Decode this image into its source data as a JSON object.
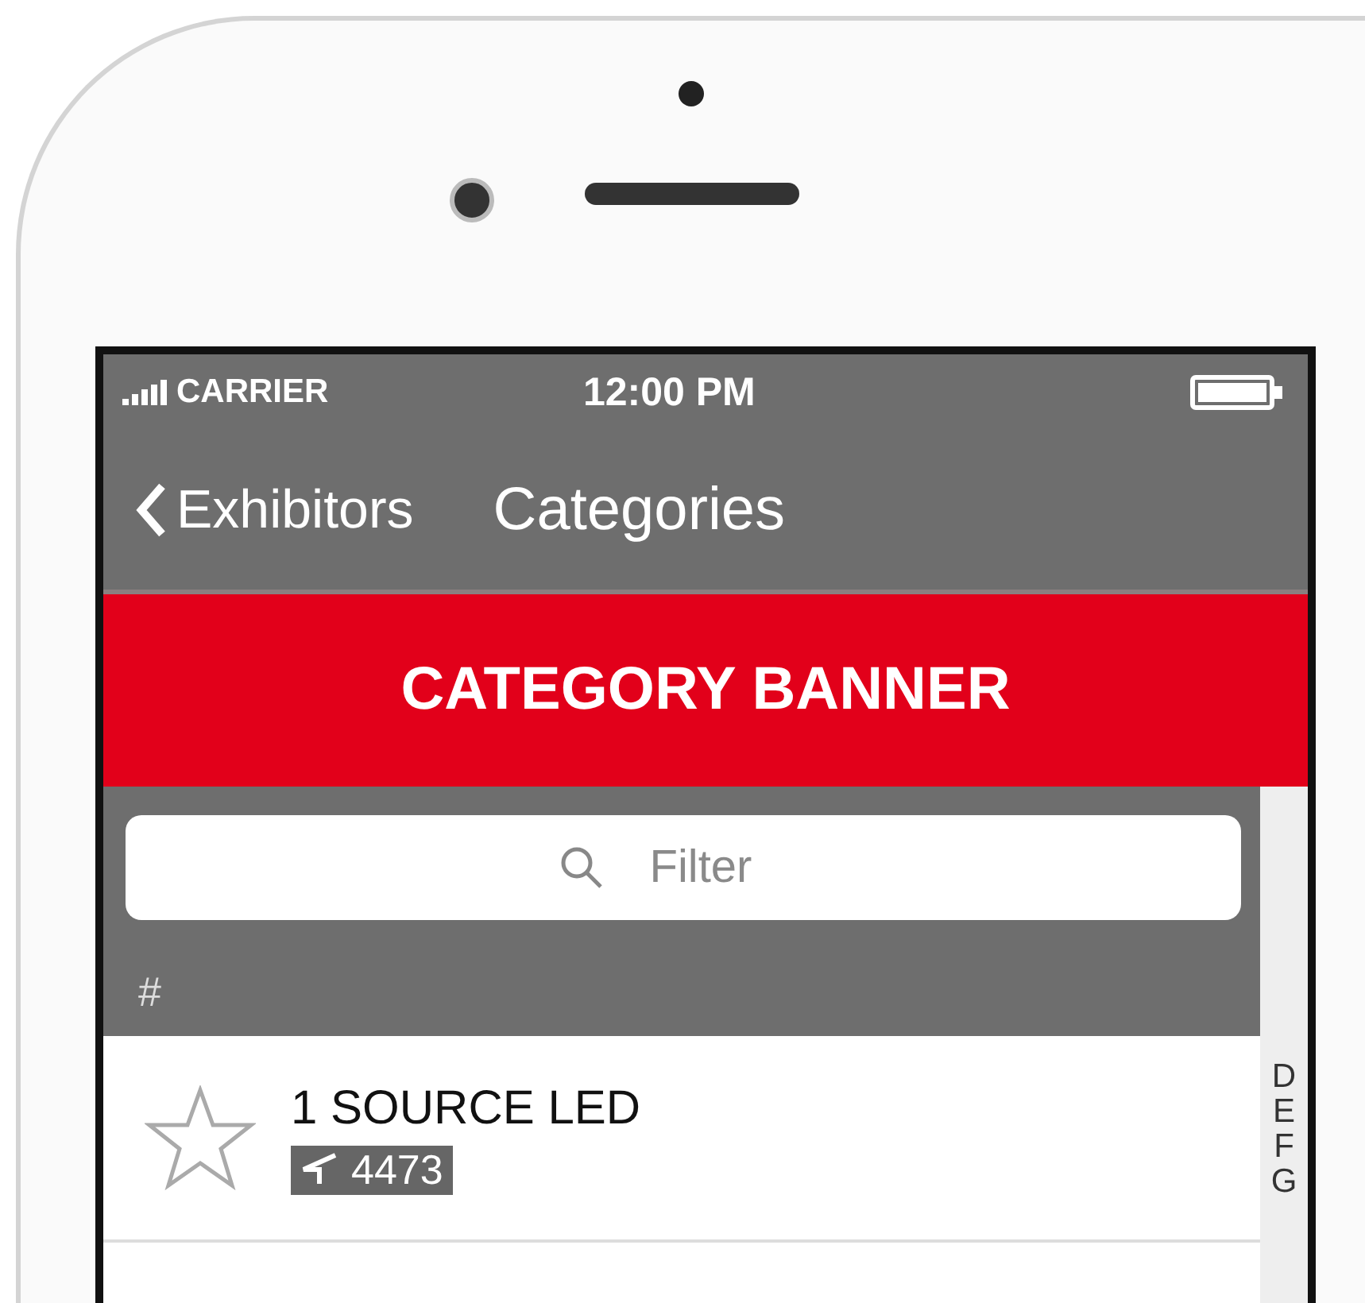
{
  "status_bar": {
    "carrier": "CARRIER",
    "time": "12:00 PM"
  },
  "nav": {
    "back": "Exhibitors",
    "title": "Categories"
  },
  "banner": {
    "text": "CATEGORY BANNER"
  },
  "search": {
    "placeholder": "Filter"
  },
  "sections": [
    {
      "header": "#",
      "rows": [
        {
          "name": "1 SOURCE LED",
          "booth": "4473",
          "favorite": false
        }
      ]
    }
  ],
  "index": [
    "D",
    "E",
    "F",
    "G"
  ]
}
